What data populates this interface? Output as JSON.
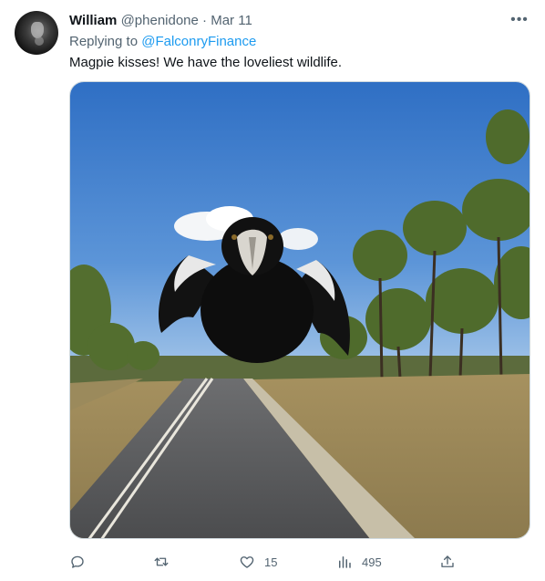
{
  "tweet": {
    "author_name": "William",
    "author_handle": "@phenidone",
    "separator": "·",
    "date": "Mar 11",
    "replying_prefix": "Replying to ",
    "replying_to": "@FalconryFinance",
    "text": "Magpie kisses!  We have the loveliest wildlife."
  },
  "media": {
    "description_icon": "photo"
  },
  "actions": {
    "reply": {
      "icon": "reply-icon",
      "count": ""
    },
    "retweet": {
      "icon": "retweet-icon",
      "count": ""
    },
    "like": {
      "icon": "heart-icon",
      "count": "15"
    },
    "views": {
      "icon": "views-icon",
      "count": "495"
    },
    "share": {
      "icon": "share-icon"
    }
  },
  "colors": {
    "text": "#0f1419",
    "muted": "#536471",
    "link": "#1d9bf0",
    "border": "#cfd9de"
  }
}
